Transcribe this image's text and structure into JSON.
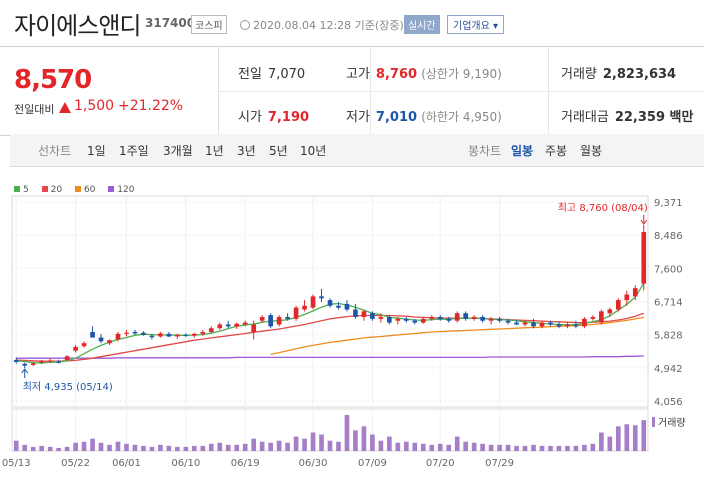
{
  "header": {
    "name": "자이에스앤디",
    "code": "317400",
    "market": "코스피",
    "datetime": "2020.08.04 12:28 기준(장중)",
    "realtime": "실시간",
    "overview": "기업개요 ▾"
  },
  "summary": {
    "price": "8,570",
    "change_label": "전일대비",
    "change": "1,500",
    "change_pct": "+21.22%",
    "prev_close_label": "전일",
    "prev_close": "7,070",
    "high_label": "고가",
    "high": "8,760",
    "upper_limit": "(상한가 9,190)",
    "volume_label": "거래량",
    "volume": "2,823,634",
    "open_label": "시가",
    "open": "7,190",
    "low_label": "저가",
    "low": "7,010",
    "lower_limit": "(하한가 4,950)",
    "amount_label": "거래대금",
    "amount": "22,359 백만"
  },
  "periods": {
    "label": "선차트",
    "items": [
      "1일",
      "1주일",
      "3개월",
      "1년",
      "3년",
      "5년",
      "10년"
    ],
    "candle_label": "봉차트",
    "candle_items": [
      "일봉",
      "주봉",
      "월봉"
    ],
    "selected_candle": "일봉"
  },
  "colors": {
    "up": "#e2272a",
    "down": "#1e55a8",
    "ma5": "#4caf50",
    "ma20": "#e24a4a",
    "ma60": "#f08c1e",
    "ma120": "#9c5ad6",
    "volume": "#a77fc9"
  },
  "chart_data": {
    "type": "candlestick",
    "legend": [
      "5",
      "20",
      "60",
      "120"
    ],
    "y_ticks": [
      "9,371",
      "8,486",
      "7,600",
      "6,714",
      "5,828",
      "4,942",
      "4,056"
    ],
    "y_range": [
      4056,
      9371
    ],
    "x_ticks": [
      "05/13",
      "05/22",
      "06/01",
      "06/10",
      "06/19",
      "06/30",
      "07/09",
      "07/20",
      "07/29"
    ],
    "annotations": {
      "high": "최고 8,760 (08/04)",
      "low": "최저 4,935 (05/14)"
    },
    "volume_label": "거래량",
    "candles": [
      {
        "o": 5150,
        "h": 5220,
        "l": 5050,
        "c": 5100
      },
      {
        "o": 5050,
        "h": 5080,
        "l": 4935,
        "c": 5000
      },
      {
        "o": 5020,
        "h": 5100,
        "l": 4990,
        "c": 5060
      },
      {
        "o": 5080,
        "h": 5150,
        "l": 5040,
        "c": 5130
      },
      {
        "o": 5120,
        "h": 5200,
        "l": 5080,
        "c": 5140
      },
      {
        "o": 5100,
        "h": 5160,
        "l": 5060,
        "c": 5090
      },
      {
        "o": 5150,
        "h": 5280,
        "l": 5120,
        "c": 5250
      },
      {
        "o": 5400,
        "h": 5550,
        "l": 5350,
        "c": 5500
      },
      {
        "o": 5520,
        "h": 5650,
        "l": 5480,
        "c": 5600
      },
      {
        "o": 5900,
        "h": 6050,
        "l": 5800,
        "c": 5750
      },
      {
        "o": 5750,
        "h": 5850,
        "l": 5600,
        "c": 5650
      },
      {
        "o": 5600,
        "h": 5700,
        "l": 5550,
        "c": 5680
      },
      {
        "o": 5700,
        "h": 5900,
        "l": 5650,
        "c": 5850
      },
      {
        "o": 5850,
        "h": 5950,
        "l": 5780,
        "c": 5880
      },
      {
        "o": 5900,
        "h": 5960,
        "l": 5820,
        "c": 5860
      },
      {
        "o": 5880,
        "h": 5920,
        "l": 5800,
        "c": 5820
      },
      {
        "o": 5800,
        "h": 5850,
        "l": 5700,
        "c": 5760
      },
      {
        "o": 5780,
        "h": 5900,
        "l": 5750,
        "c": 5860
      },
      {
        "o": 5850,
        "h": 5900,
        "l": 5760,
        "c": 5780
      },
      {
        "o": 5780,
        "h": 5850,
        "l": 5720,
        "c": 5830
      },
      {
        "o": 5820,
        "h": 5870,
        "l": 5760,
        "c": 5800
      },
      {
        "o": 5800,
        "h": 5880,
        "l": 5750,
        "c": 5850
      },
      {
        "o": 5850,
        "h": 5950,
        "l": 5800,
        "c": 5900
      },
      {
        "o": 5900,
        "h": 6050,
        "l": 5850,
        "c": 6000
      },
      {
        "o": 6000,
        "h": 6150,
        "l": 5950,
        "c": 6100
      },
      {
        "o": 6100,
        "h": 6200,
        "l": 6000,
        "c": 6050
      },
      {
        "o": 6050,
        "h": 6150,
        "l": 5980,
        "c": 6120
      },
      {
        "o": 6100,
        "h": 6200,
        "l": 6050,
        "c": 6150
      },
      {
        "o": 5900,
        "h": 6200,
        "l": 5700,
        "c": 6100
      },
      {
        "o": 6200,
        "h": 6350,
        "l": 6150,
        "c": 6300
      },
      {
        "o": 6350,
        "h": 6400,
        "l": 6000,
        "c": 6050
      },
      {
        "o": 6100,
        "h": 6350,
        "l": 6050,
        "c": 6300
      },
      {
        "o": 6300,
        "h": 6400,
        "l": 6200,
        "c": 6250
      },
      {
        "o": 6250,
        "h": 6600,
        "l": 6200,
        "c": 6550
      },
      {
        "o": 6500,
        "h": 6750,
        "l": 6450,
        "c": 6600
      },
      {
        "o": 6550,
        "h": 6900,
        "l": 6500,
        "c": 6850
      },
      {
        "o": 6850,
        "h": 7050,
        "l": 6700,
        "c": 6800
      },
      {
        "o": 6750,
        "h": 6800,
        "l": 6550,
        "c": 6600
      },
      {
        "o": 6600,
        "h": 6700,
        "l": 6500,
        "c": 6550
      },
      {
        "o": 6650,
        "h": 6750,
        "l": 6450,
        "c": 6500
      },
      {
        "o": 6500,
        "h": 6650,
        "l": 6250,
        "c": 6300
      },
      {
        "o": 6300,
        "h": 6500,
        "l": 6200,
        "c": 6450
      },
      {
        "o": 6400,
        "h": 6450,
        "l": 6200,
        "c": 6250
      },
      {
        "o": 6250,
        "h": 6400,
        "l": 6150,
        "c": 6300
      },
      {
        "o": 6300,
        "h": 6350,
        "l": 6100,
        "c": 6150
      },
      {
        "o": 6200,
        "h": 6300,
        "l": 6100,
        "c": 6250
      },
      {
        "o": 6250,
        "h": 6300,
        "l": 6150,
        "c": 6200
      },
      {
        "o": 6200,
        "h": 6250,
        "l": 6100,
        "c": 6150
      },
      {
        "o": 6150,
        "h": 6300,
        "l": 6120,
        "c": 6250
      },
      {
        "o": 6250,
        "h": 6350,
        "l": 6200,
        "c": 6300
      },
      {
        "o": 6300,
        "h": 6350,
        "l": 6200,
        "c": 6250
      },
      {
        "o": 6250,
        "h": 6300,
        "l": 6150,
        "c": 6200
      },
      {
        "o": 6200,
        "h": 6450,
        "l": 6150,
        "c": 6400
      },
      {
        "o": 6400,
        "h": 6450,
        "l": 6200,
        "c": 6250
      },
      {
        "o": 6250,
        "h": 6350,
        "l": 6200,
        "c": 6300
      },
      {
        "o": 6300,
        "h": 6350,
        "l": 6150,
        "c": 6200
      },
      {
        "o": 6200,
        "h": 6300,
        "l": 6100,
        "c": 6250
      },
      {
        "o": 6250,
        "h": 6300,
        "l": 6150,
        "c": 6200
      },
      {
        "o": 6200,
        "h": 6250,
        "l": 6100,
        "c": 6150
      },
      {
        "o": 6150,
        "h": 6220,
        "l": 6080,
        "c": 6100
      },
      {
        "o": 6100,
        "h": 6200,
        "l": 6050,
        "c": 6150
      },
      {
        "o": 6150,
        "h": 6250,
        "l": 6000,
        "c": 6050
      },
      {
        "o": 6050,
        "h": 6200,
        "l": 6000,
        "c": 6150
      },
      {
        "o": 6150,
        "h": 6200,
        "l": 6050,
        "c": 6100
      },
      {
        "o": 6100,
        "h": 6180,
        "l": 6000,
        "c": 6050
      },
      {
        "o": 6050,
        "h": 6150,
        "l": 6000,
        "c": 6100
      },
      {
        "o": 6100,
        "h": 6200,
        "l": 6000,
        "c": 6050
      },
      {
        "o": 6050,
        "h": 6300,
        "l": 6000,
        "c": 6250
      },
      {
        "o": 6250,
        "h": 6350,
        "l": 6200,
        "c": 6300
      },
      {
        "o": 6150,
        "h": 6500,
        "l": 6100,
        "c": 6450
      },
      {
        "o": 6400,
        "h": 6550,
        "l": 6300,
        "c": 6500
      },
      {
        "o": 6500,
        "h": 6800,
        "l": 6450,
        "c": 6750
      },
      {
        "o": 6750,
        "h": 7000,
        "l": 6600,
        "c": 6900
      },
      {
        "o": 6850,
        "h": 7150,
        "l": 6750,
        "c": 7070
      },
      {
        "o": 7190,
        "h": 8760,
        "l": 7010,
        "c": 8570
      }
    ],
    "ma5": [
      5130,
      5110,
      5080,
      5070,
      5090,
      5100,
      5130,
      5200,
      5320,
      5440,
      5540,
      5630,
      5700,
      5750,
      5810,
      5840,
      5830,
      5820,
      5820,
      5810,
      5810,
      5820,
      5830,
      5870,
      5920,
      5990,
      6050,
      6090,
      6110,
      6160,
      6190,
      6200,
      6230,
      6290,
      6370,
      6460,
      6560,
      6640,
      6660,
      6620,
      6560,
      6480,
      6400,
      6360,
      6290,
      6270,
      6240,
      6220,
      6210,
      6230,
      6240,
      6240,
      6260,
      6270,
      6270,
      6260,
      6240,
      6230,
      6220,
      6200,
      6170,
      6150,
      6130,
      6110,
      6100,
      6090,
      6090,
      6130,
      6170,
      6230,
      6330,
      6480,
      6640,
      6830,
      7200
    ],
    "ma20": [
      5150,
      5140,
      5130,
      5120,
      5120,
      5120,
      5130,
      5140,
      5170,
      5200,
      5240,
      5280,
      5320,
      5360,
      5400,
      5440,
      5480,
      5520,
      5560,
      5600,
      5640,
      5680,
      5710,
      5740,
      5770,
      5800,
      5830,
      5860,
      5890,
      5920,
      5950,
      5980,
      6020,
      6060,
      6100,
      6150,
      6200,
      6250,
      6280,
      6310,
      6330,
      6340,
      6340,
      6340,
      6340,
      6330,
      6320,
      6300,
      6290,
      6280,
      6270,
      6270,
      6270,
      6270,
      6270,
      6260,
      6250,
      6240,
      6230,
      6220,
      6210,
      6200,
      6190,
      6180,
      6170,
      6160,
      6150,
      6150,
      6160,
      6170,
      6190,
      6220,
      6260,
      6320,
      6400
    ],
    "ma60": [
      null,
      null,
      null,
      null,
      null,
      null,
      null,
      null,
      null,
      null,
      null,
      null,
      null,
      null,
      null,
      null,
      null,
      null,
      null,
      null,
      null,
      null,
      null,
      null,
      null,
      null,
      null,
      null,
      null,
      null,
      5300,
      5350,
      5400,
      5450,
      5500,
      5540,
      5580,
      5620,
      5650,
      5680,
      5710,
      5740,
      5760,
      5780,
      5800,
      5820,
      5840,
      5860,
      5880,
      5900,
      5910,
      5920,
      5930,
      5940,
      5950,
      5960,
      5970,
      5980,
      5990,
      6000,
      6010,
      6020,
      6030,
      6040,
      6050,
      6060,
      6070,
      6080,
      6100,
      6120,
      6150,
      6180,
      6210,
      6250,
      6290
    ],
    "ma120": [
      5200,
      5200,
      5200,
      5200,
      5200,
      5200,
      5200,
      5200,
      5200,
      5200,
      5200,
      5200,
      5210,
      5210,
      5210,
      5210,
      5210,
      5210,
      5210,
      5210,
      5210,
      5210,
      5210,
      5210,
      5210,
      5210,
      5220,
      5220,
      5220,
      5220,
      5220,
      5220,
      5220,
      5220,
      5220,
      5220,
      5220,
      5220,
      5220,
      5220,
      5220,
      5220,
      5220,
      5220,
      5220,
      5220,
      5220,
      5220,
      5220,
      5220,
      5220,
      5220,
      5220,
      5220,
      5220,
      5220,
      5230,
      5230,
      5230,
      5230,
      5230,
      5230,
      5230,
      5230,
      5230,
      5230,
      5230,
      5230,
      5240,
      5240,
      5240,
      5240,
      5250,
      5250,
      5260
    ],
    "volume": [
      10,
      6,
      4,
      5,
      4,
      3,
      4,
      8,
      9,
      12,
      8,
      6,
      9,
      7,
      6,
      5,
      4,
      6,
      5,
      4,
      4,
      5,
      5,
      7,
      8,
      6,
      6,
      7,
      12,
      9,
      8,
      10,
      8,
      14,
      12,
      18,
      16,
      10,
      9,
      35,
      20,
      24,
      16,
      10,
      14,
      8,
      9,
      8,
      7,
      6,
      7,
      6,
      14,
      9,
      8,
      7,
      6,
      6,
      6,
      5,
      5,
      6,
      5,
      5,
      5,
      5,
      5,
      6,
      7,
      18,
      14,
      24,
      26,
      25,
      30
    ]
  }
}
